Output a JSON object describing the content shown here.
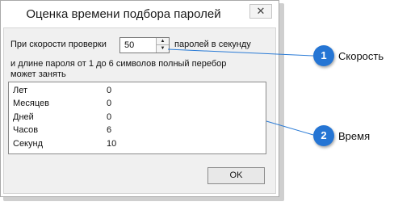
{
  "window": {
    "title": "Оценка времени подбора паролей",
    "close_glyph": "✕"
  },
  "speed": {
    "label_before": "При скорости проверки",
    "value": "50",
    "label_after": "паролей в секунду",
    "up_glyph": "▲",
    "down_glyph": "▼"
  },
  "description": {
    "line1": "и длине пароля от  1 до 6 символов полный перебор",
    "line2": "может занять"
  },
  "results": [
    {
      "label": "Лет",
      "value": "0"
    },
    {
      "label": "Месяцев",
      "value": "0"
    },
    {
      "label": "Дней",
      "value": "0"
    },
    {
      "label": "Часов",
      "value": "6"
    },
    {
      "label": "Секунд",
      "value": "10"
    }
  ],
  "ok_label": "OK",
  "callouts": [
    {
      "number": "1",
      "label": "Скорость"
    },
    {
      "number": "2",
      "label": "Время"
    }
  ],
  "colors": {
    "badge": "#2575d4",
    "line": "#2a7bd6"
  }
}
